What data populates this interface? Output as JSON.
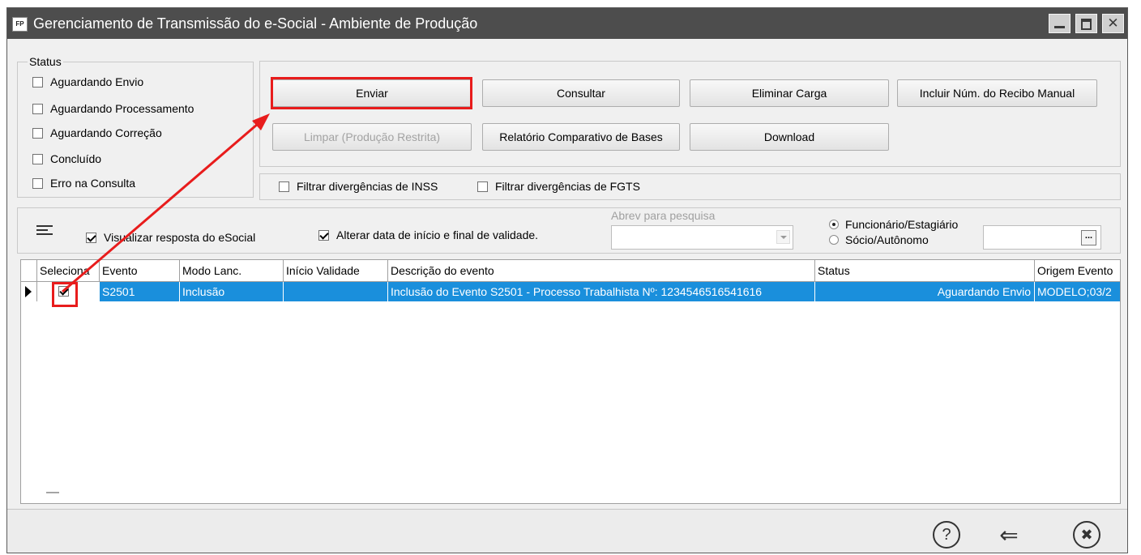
{
  "window": {
    "app_icon": "FP",
    "title": "Gerenciamento de Transmissão do e-Social - Ambiente de Produção",
    "controls": [
      "minimize-icon",
      "maximize-icon",
      "close-icon"
    ]
  },
  "status": {
    "legend": "Status",
    "options": [
      {
        "label": "Aguardando Envio",
        "checked": false
      },
      {
        "label": "Aguardando Processamento",
        "checked": false
      },
      {
        "label": "Aguardando Correção",
        "checked": false
      },
      {
        "label": "Concluído",
        "checked": false
      },
      {
        "label": "Erro na Consulta",
        "checked": false
      }
    ]
  },
  "actions": {
    "enviar": "Enviar",
    "consultar": "Consultar",
    "eliminar_carga": "Eliminar Carga",
    "incluir_recibo": "Incluir Núm. do Recibo Manual",
    "limpar": "Limpar (Produção Restrita)",
    "relatorio": "Relatório Comparativo de Bases",
    "download": "Download"
  },
  "filters": {
    "inss": {
      "label": "Filtrar divergências de INSS",
      "checked": false
    },
    "fgts": {
      "label": "Filtrar divergências de FGTS",
      "checked": false
    }
  },
  "options_bar": {
    "visualizar": {
      "label": "Visualizar resposta do eSocial",
      "checked": true
    },
    "alterar_data": {
      "label": "Alterar data de início e final de validade.",
      "checked": true
    },
    "abrev_label": "Abrev para pesquisa",
    "abrev_value": "",
    "radio_funcionario": "Funcionário/Estagiário",
    "radio_socio": "Sócio/Autônomo",
    "selected_radio": "funcionario",
    "lookup_value": "",
    "lookup_button": "..."
  },
  "grid": {
    "columns": [
      "Seleciona",
      "Evento",
      "Modo Lanc.",
      "Início Validade",
      "Descrição do evento",
      "Status",
      "Origem Evento"
    ],
    "rows": [
      {
        "selected": true,
        "evento": "S2501",
        "modo": "Inclusão",
        "inicio": "",
        "descricao": "Inclusão do Evento S2501 - Processo Trabalhista Nº: 1234546516541616",
        "status": "Aguardando Envio",
        "origem": "MODELO;03/2"
      }
    ],
    "footer_marker": "—"
  },
  "footer": {
    "icons": [
      "help-icon",
      "back-arrow-icon",
      "close-circle-icon"
    ],
    "help_glyph": "?",
    "back_glyph": "⇐",
    "close_glyph": "✖"
  },
  "highlight_color": "#e81c1c",
  "selection_color": "#1a8fdc"
}
